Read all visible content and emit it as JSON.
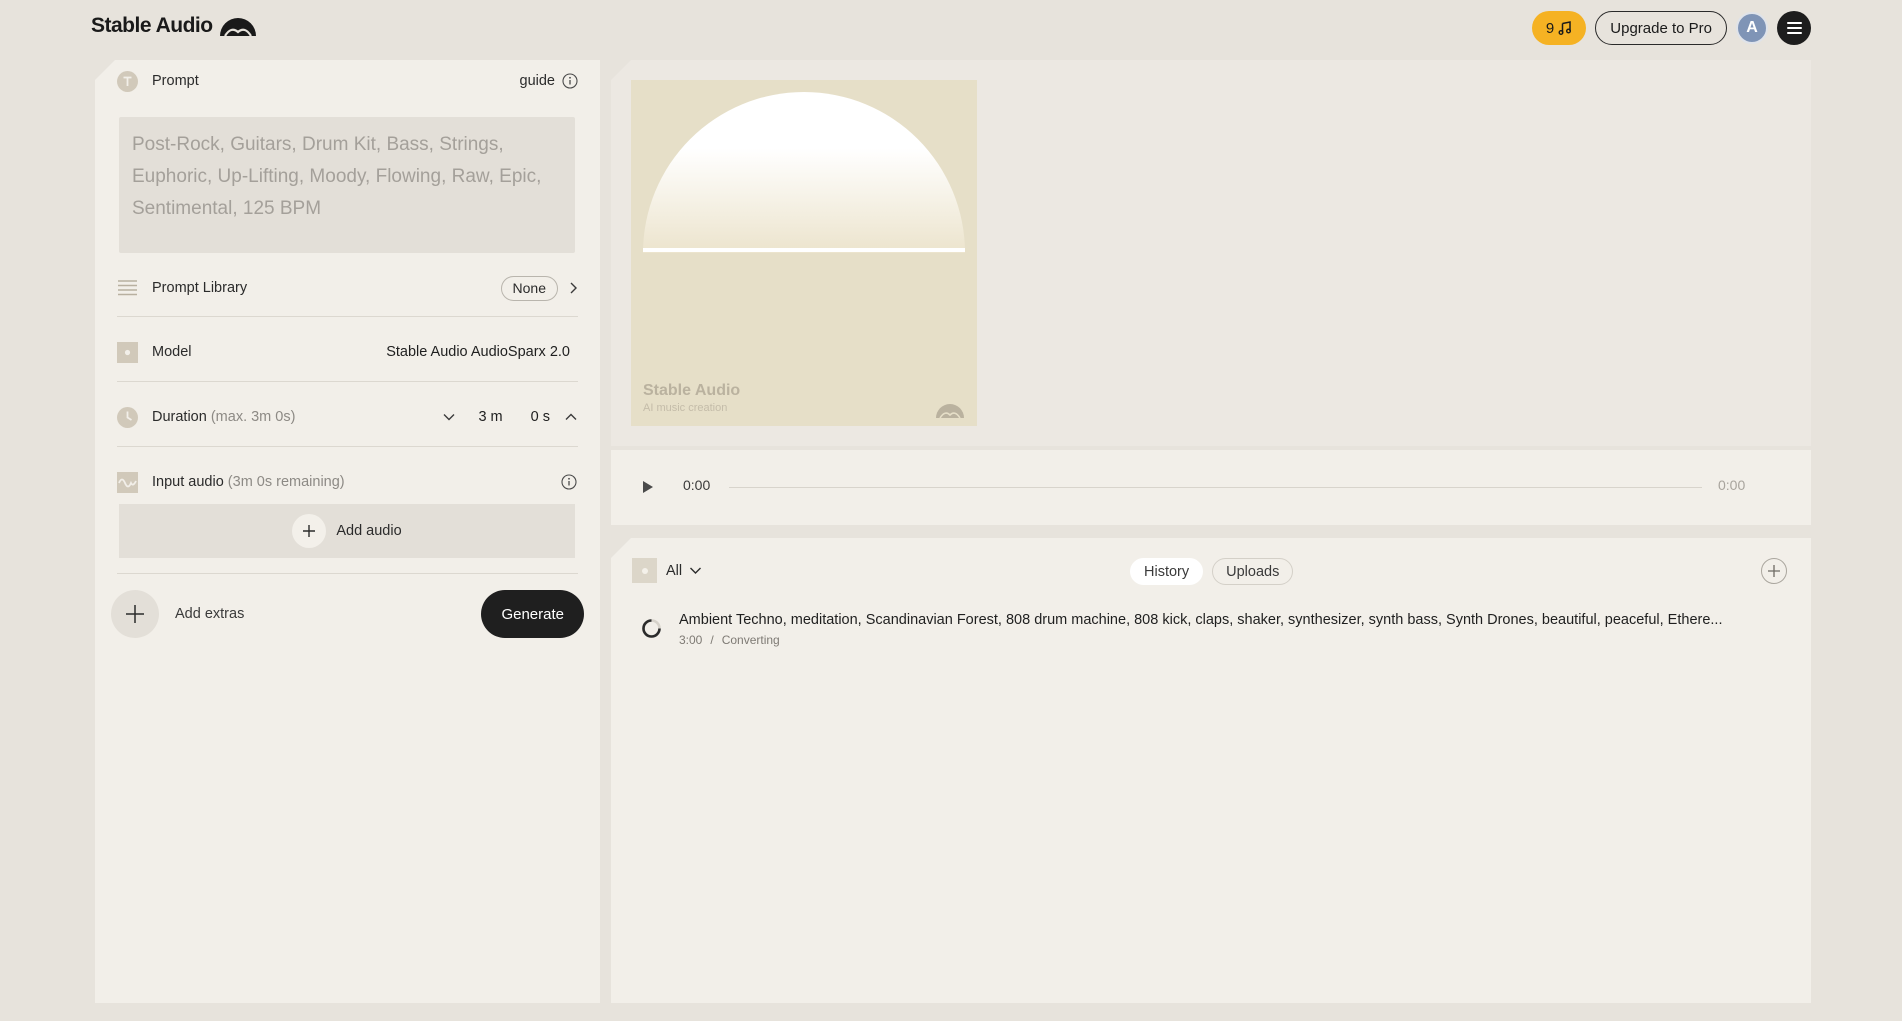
{
  "header": {
    "logo_text": "Stable Audio",
    "credits_count": "9",
    "upgrade_label": "Upgrade to Pro",
    "avatar_letter": "A"
  },
  "prompt": {
    "label": "Prompt",
    "guide_label": "guide",
    "placeholder": "Post-Rock, Guitars, Drum Kit, Bass, Strings, Euphoric, Up-Lifting, Moody, Flowing, Raw, Epic, Sentimental, 125 BPM",
    "value": ""
  },
  "prompt_library": {
    "label": "Prompt Library",
    "value": "None"
  },
  "model": {
    "label": "Model",
    "value": "Stable Audio AudioSparx 2.0"
  },
  "duration": {
    "label": "Duration",
    "hint": "(max. 3m 0s)",
    "minutes": "3",
    "minutes_unit": "m",
    "seconds": "0",
    "seconds_unit": "s"
  },
  "input_audio": {
    "label": "Input audio",
    "hint": "(3m 0s remaining)",
    "add_label": "Add audio"
  },
  "extras": {
    "label": "Add extras"
  },
  "generate_label": "Generate",
  "cover": {
    "title": "Stable Audio",
    "subtitle": "AI music creation"
  },
  "player": {
    "current_time": "0:00",
    "total_time": "0:00",
    "progress": 0
  },
  "history": {
    "filter_label": "All",
    "tabs": [
      {
        "label": "History",
        "active": true
      },
      {
        "label": "Uploads",
        "active": false
      }
    ],
    "items": [
      {
        "title": "Ambient Techno, meditation, Scandinavian Forest, 808 drum machine, 808 kick, claps, shaker, synthesizer, synth bass, Synth Drones, beautiful, peaceful, Ethere...",
        "duration": "3:00",
        "separator": "/",
        "status": "Converting"
      }
    ]
  },
  "colors": {
    "page_bg": "#e7e3dc",
    "panel_bg": "#f2efe9",
    "credits_accent": "#f5b223",
    "button_dark": "#1f1f1f",
    "avatar": "#7f94b6"
  }
}
